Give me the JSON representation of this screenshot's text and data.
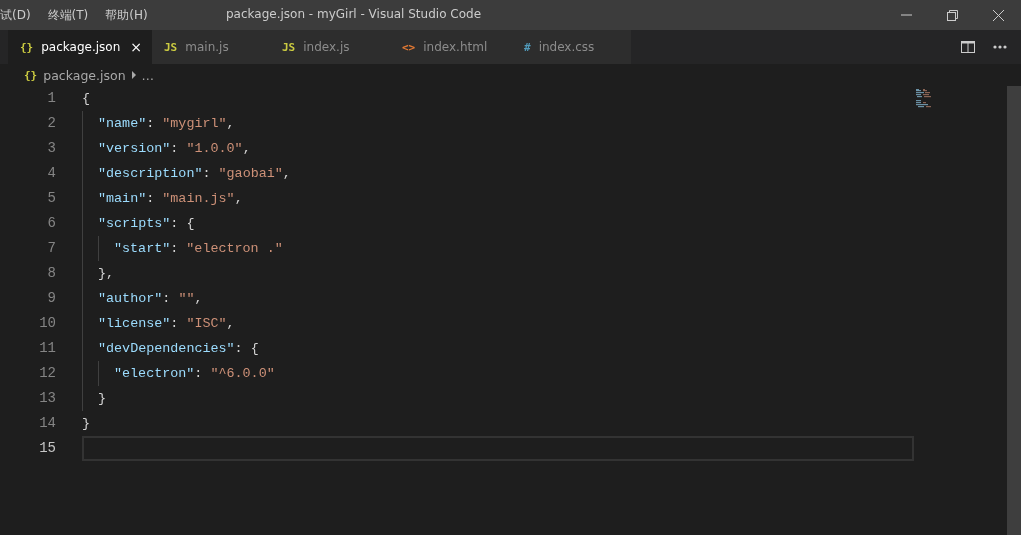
{
  "menu": [
    {
      "label": "试(D)"
    },
    {
      "label": "终端(T)"
    },
    {
      "label": "帮助(H)"
    }
  ],
  "window": {
    "title": "package.json - myGirl - Visual Studio Code"
  },
  "tabs": [
    {
      "icon": "{}",
      "color": "#cbcb41",
      "label": "package.json",
      "selected": true,
      "close": "×"
    },
    {
      "icon": "JS",
      "color": "#cbcb41",
      "label": "main.js",
      "selected": false
    },
    {
      "icon": "JS",
      "color": "#cbcb41",
      "label": "index.js",
      "selected": false
    },
    {
      "icon": "<>",
      "color": "#e37933",
      "label": "index.html",
      "selected": false
    },
    {
      "icon": "#",
      "color": "#519aba",
      "label": "index.css",
      "selected": false
    }
  ],
  "breadcrumb": {
    "icon": "{}",
    "file": "package.json",
    "more": "…"
  },
  "lines": [
    {
      "number": "1",
      "current": false,
      "tokens": [
        {
          "kind": "punct",
          "text": "{"
        }
      ],
      "children": [
        {
          "number": "2",
          "current": false,
          "tokens": [
            {
              "kind": "key",
              "text": "\"name\""
            },
            {
              "kind": "punct",
              "text": ": "
            },
            {
              "kind": "string",
              "text": "\"mygirl\""
            },
            {
              "kind": "punct",
              "text": ","
            }
          ]
        },
        {
          "number": "3",
          "current": false,
          "tokens": [
            {
              "kind": "key",
              "text": "\"version\""
            },
            {
              "kind": "punct",
              "text": ": "
            },
            {
              "kind": "string",
              "text": "\"1.0.0\""
            },
            {
              "kind": "punct",
              "text": ","
            }
          ]
        },
        {
          "number": "4",
          "current": false,
          "tokens": [
            {
              "kind": "key",
              "text": "\"description\""
            },
            {
              "kind": "punct",
              "text": ": "
            },
            {
              "kind": "string",
              "text": "\"gaobai\""
            },
            {
              "kind": "punct",
              "text": ","
            }
          ]
        },
        {
          "number": "5",
          "current": false,
          "tokens": [
            {
              "kind": "key",
              "text": "\"main\""
            },
            {
              "kind": "punct",
              "text": ": "
            },
            {
              "kind": "string",
              "text": "\"main.js\""
            },
            {
              "kind": "punct",
              "text": ","
            }
          ]
        },
        {
          "number": "6",
          "current": false,
          "tokens": [
            {
              "kind": "key",
              "text": "\"scripts\""
            },
            {
              "kind": "punct",
              "text": ": {"
            }
          ],
          "children": [
            {
              "number": "7",
              "current": false,
              "tokens": [
                {
                  "kind": "key",
                  "text": "\"start\""
                },
                {
                  "kind": "punct",
                  "text": ": "
                },
                {
                  "kind": "string",
                  "text": "\"electron .\""
                }
              ]
            }
          ]
        },
        {
          "number": "8",
          "current": false,
          "tokens": [
            {
              "kind": "punct",
              "text": "},"
            }
          ]
        },
        {
          "number": "9",
          "current": false,
          "tokens": [
            {
              "kind": "key",
              "text": "\"author\""
            },
            {
              "kind": "punct",
              "text": ": "
            },
            {
              "kind": "string",
              "text": "\"\""
            },
            {
              "kind": "punct",
              "text": ","
            }
          ]
        },
        {
          "number": "10",
          "current": false,
          "tokens": [
            {
              "kind": "key",
              "text": "\"license\""
            },
            {
              "kind": "punct",
              "text": ": "
            },
            {
              "kind": "string",
              "text": "\"ISC\""
            },
            {
              "kind": "punct",
              "text": ","
            }
          ]
        },
        {
          "number": "11",
          "current": false,
          "tokens": [
            {
              "kind": "key",
              "text": "\"devDependencies\""
            },
            {
              "kind": "punct",
              "text": ": {"
            }
          ],
          "children": [
            {
              "number": "12",
              "current": false,
              "tokens": [
                {
                  "kind": "key",
                  "text": "\"electron\""
                },
                {
                  "kind": "punct",
                  "text": ": "
                },
                {
                  "kind": "string",
                  "text": "\"^6.0.0\""
                }
              ]
            }
          ]
        },
        {
          "number": "13",
          "current": false,
          "tokens": [
            {
              "kind": "punct",
              "text": "}"
            }
          ]
        }
      ]
    },
    {
      "number": "14",
      "current": false,
      "tokens": [
        {
          "kind": "punct",
          "text": "}"
        }
      ]
    },
    {
      "number": "15",
      "current": true
    }
  ]
}
